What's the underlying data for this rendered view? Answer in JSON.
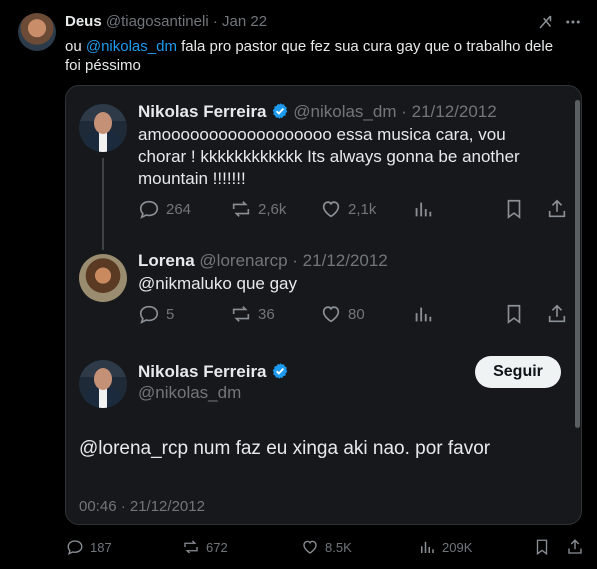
{
  "tweet": {
    "author_name": "Deus",
    "author_handle": "@tiagosantineli",
    "separator": "·",
    "date": "Jan 22",
    "text_prefix": "ou ",
    "mention": "@nikolas_dm",
    "text_rest": " fala pro pastor que fez sua cura gay que o trabalho dele foi péssimo",
    "icons": [
      "grok-icon",
      "more-icon"
    ]
  },
  "quoted": {
    "post1": {
      "name": "Nikolas Ferreira",
      "handle": "@nikolas_dm",
      "date": "· 21/12/2012",
      "text": "amoooooooooooooooooo essa musica cara, vou chorar ! kkkkkkkkkkkk Its always gonna be another mountain !!!!!!!",
      "replies": "264",
      "reposts": "2,6k",
      "likes": "2,1k"
    },
    "post2": {
      "name": "Lorena",
      "handle": "@lorenarcp",
      "date": "· 21/12/2012",
      "text": "@nikmaluko que gay",
      "replies": "5",
      "reposts": "36",
      "likes": "80"
    },
    "post3": {
      "name": "Nikolas Ferreira",
      "handle": "@nikolas_dm",
      "follow_label": "Seguir",
      "text": "@lorena_rcp num faz eu xinga aki nao. por favor",
      "timestamp": "00:46 · 21/12/2012"
    }
  },
  "bottom_actions": {
    "replies": "187",
    "reposts": "672",
    "likes": "8.5K",
    "views": "209K"
  },
  "colors": {
    "background": "#000000",
    "card": "#16181c",
    "accent": "#1d9bf0",
    "muted": "#71767b",
    "text": "#e7e9ea"
  }
}
